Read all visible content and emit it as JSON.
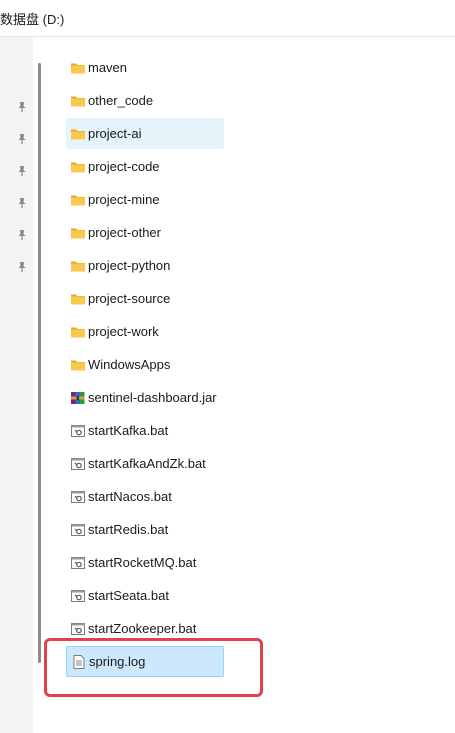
{
  "window": {
    "title": "数据盘 (D:)"
  },
  "nav_pane": {
    "pins": [
      "pin-icon",
      "pin-icon",
      "pin-icon",
      "pin-icon",
      "pin-icon",
      "pin-icon"
    ]
  },
  "files": [
    {
      "name": "maven",
      "icon": "folder-icon",
      "state": "normal"
    },
    {
      "name": "other_code",
      "icon": "folder-icon",
      "state": "normal"
    },
    {
      "name": "project-ai",
      "icon": "folder-icon",
      "state": "hover"
    },
    {
      "name": "project-code",
      "icon": "folder-icon",
      "state": "normal"
    },
    {
      "name": "project-mine",
      "icon": "folder-icon",
      "state": "normal"
    },
    {
      "name": "project-other",
      "icon": "folder-icon",
      "state": "normal"
    },
    {
      "name": "project-python",
      "icon": "folder-icon",
      "state": "normal"
    },
    {
      "name": "project-source",
      "icon": "folder-icon",
      "state": "normal"
    },
    {
      "name": "project-work",
      "icon": "folder-icon",
      "state": "normal"
    },
    {
      "name": "WindowsApps",
      "icon": "folder-icon",
      "state": "normal"
    },
    {
      "name": "sentinel-dashboard.jar",
      "icon": "archive-icon",
      "state": "normal"
    },
    {
      "name": "startKafka.bat",
      "icon": "batch-file-icon",
      "state": "normal"
    },
    {
      "name": "startKafkaAndZk.bat",
      "icon": "batch-file-icon",
      "state": "normal"
    },
    {
      "name": "startNacos.bat",
      "icon": "batch-file-icon",
      "state": "normal"
    },
    {
      "name": "startRedis.bat",
      "icon": "batch-file-icon",
      "state": "normal"
    },
    {
      "name": "startRocketMQ.bat",
      "icon": "batch-file-icon",
      "state": "normal"
    },
    {
      "name": "startSeata.bat",
      "icon": "batch-file-icon",
      "state": "normal"
    },
    {
      "name": "startZookeeper.bat",
      "icon": "batch-file-icon",
      "state": "normal"
    },
    {
      "name": "spring.log",
      "icon": "text-file-icon",
      "state": "selected"
    }
  ],
  "colors": {
    "selection": "#cce8ff",
    "hover": "#e5f3fb",
    "annotation_border": "#e0414d",
    "folder": "#f8c94c"
  }
}
